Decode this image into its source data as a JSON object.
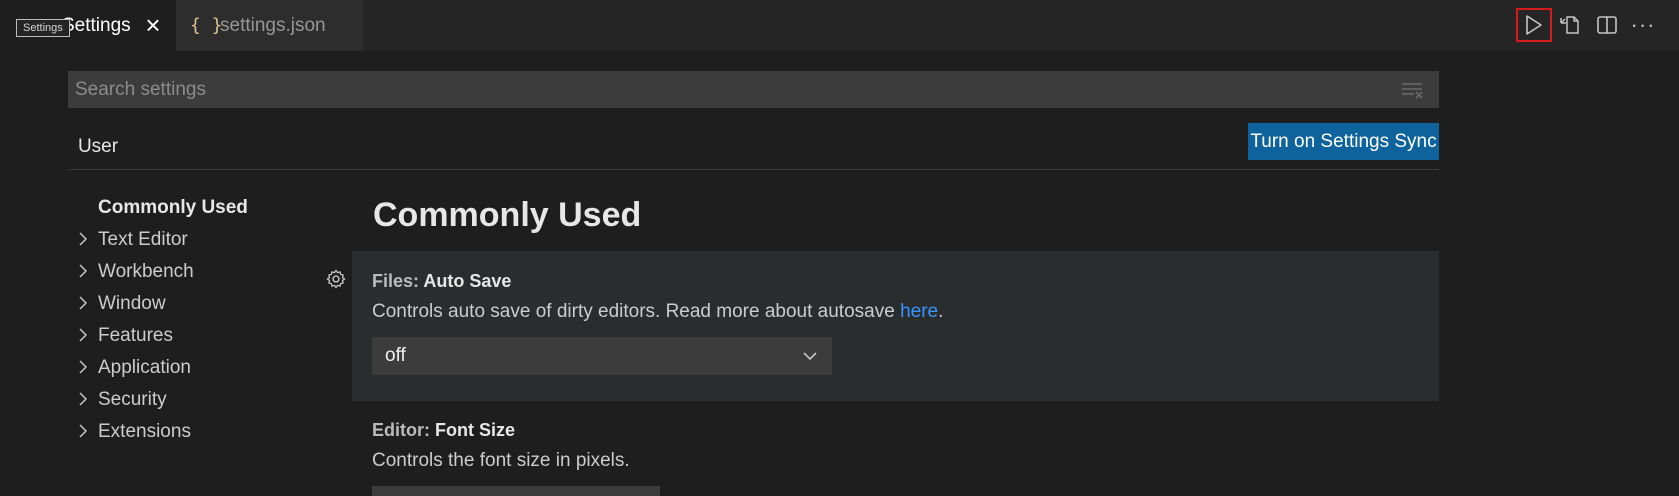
{
  "tabs": {
    "active": {
      "label": "Settings",
      "close": "×"
    },
    "inactive": {
      "icon": "{ }",
      "label": "settings.json"
    },
    "tooltip": "Settings"
  },
  "toolbar": {
    "run_icon": "run-icon",
    "open_json_icon": "open-settings-json-icon",
    "split_icon": "split-editor-icon",
    "more_label": "···"
  },
  "search": {
    "placeholder": "Search settings",
    "value": ""
  },
  "scope": {
    "user_label": "User"
  },
  "sync_button": {
    "label": "Turn on Settings Sync",
    "color": "#0e639c"
  },
  "toc": {
    "items": [
      {
        "label": "Commonly Used",
        "expandable": false,
        "bold": true
      },
      {
        "label": "Text Editor",
        "expandable": true
      },
      {
        "label": "Workbench",
        "expandable": true
      },
      {
        "label": "Window",
        "expandable": true
      },
      {
        "label": "Features",
        "expandable": true
      },
      {
        "label": "Application",
        "expandable": true
      },
      {
        "label": "Security",
        "expandable": true
      },
      {
        "label": "Extensions",
        "expandable": true
      }
    ]
  },
  "main": {
    "heading": "Commonly Used",
    "settings": [
      {
        "category": "Files: ",
        "key": "Auto Save",
        "description": "Controls auto save of dirty editors. Read more about autosave ",
        "link": "here",
        "suffix": ".",
        "value": "off"
      },
      {
        "category": "Editor: ",
        "key": "Font Size",
        "description": "Controls the font size in pixels."
      }
    ]
  },
  "colors": {
    "accent": "#0e639c",
    "link": "#3794ff",
    "highlight": "#d41a1a"
  }
}
